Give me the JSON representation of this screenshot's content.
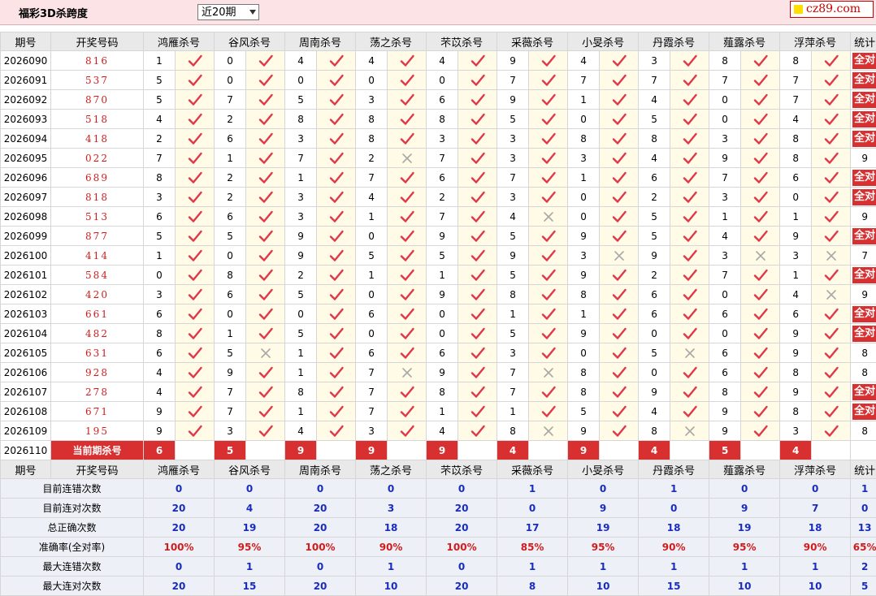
{
  "header": {
    "title": "福彩3D杀跨度",
    "select_value": "近20期",
    "logo_text": "cz89.com"
  },
  "table": {
    "col_period": "期号",
    "col_draw": "开奖号码",
    "experts": [
      "鸿雁杀号",
      "谷风杀号",
      "周南杀号",
      "荡之杀号",
      "芣苡杀号",
      "采薇杀号",
      "小旻杀号",
      "丹霞杀号",
      "薤露杀号",
      "浮萍杀号"
    ],
    "col_stat": "统计",
    "rows": [
      {
        "period": "2026090",
        "draw": "816",
        "kills": [
          1,
          0,
          4,
          4,
          4,
          9,
          4,
          3,
          8,
          8
        ],
        "marks": [
          1,
          1,
          1,
          1,
          1,
          1,
          1,
          1,
          1,
          1
        ],
        "stat": "全对"
      },
      {
        "period": "2026091",
        "draw": "537",
        "kills": [
          5,
          0,
          0,
          0,
          0,
          7,
          7,
          7,
          7,
          7
        ],
        "marks": [
          1,
          1,
          1,
          1,
          1,
          1,
          1,
          1,
          1,
          1
        ],
        "stat": "全对"
      },
      {
        "period": "2026092",
        "draw": "870",
        "kills": [
          5,
          7,
          5,
          3,
          6,
          9,
          1,
          4,
          0,
          7
        ],
        "marks": [
          1,
          1,
          1,
          1,
          1,
          1,
          1,
          1,
          1,
          1
        ],
        "stat": "全对"
      },
      {
        "period": "2026093",
        "draw": "518",
        "kills": [
          4,
          2,
          8,
          8,
          8,
          5,
          0,
          5,
          0,
          4
        ],
        "marks": [
          1,
          1,
          1,
          1,
          1,
          1,
          1,
          1,
          1,
          1
        ],
        "stat": "全对"
      },
      {
        "period": "2026094",
        "draw": "418",
        "kills": [
          2,
          6,
          3,
          8,
          3,
          3,
          8,
          8,
          3,
          8
        ],
        "marks": [
          1,
          1,
          1,
          1,
          1,
          1,
          1,
          1,
          1,
          1
        ],
        "stat": "全对"
      },
      {
        "period": "2026095",
        "draw": "022",
        "kills": [
          7,
          1,
          7,
          2,
          7,
          3,
          3,
          4,
          9,
          8
        ],
        "marks": [
          1,
          1,
          1,
          0,
          1,
          1,
          1,
          1,
          1,
          1
        ],
        "stat": "9"
      },
      {
        "period": "2026096",
        "draw": "689",
        "kills": [
          8,
          2,
          1,
          7,
          6,
          7,
          1,
          6,
          7,
          6
        ],
        "marks": [
          1,
          1,
          1,
          1,
          1,
          1,
          1,
          1,
          1,
          1
        ],
        "stat": "全对"
      },
      {
        "period": "2026097",
        "draw": "818",
        "kills": [
          3,
          2,
          3,
          4,
          2,
          3,
          0,
          2,
          3,
          0
        ],
        "marks": [
          1,
          1,
          1,
          1,
          1,
          1,
          1,
          1,
          1,
          1
        ],
        "stat": "全对"
      },
      {
        "period": "2026098",
        "draw": "513",
        "kills": [
          6,
          6,
          3,
          1,
          7,
          4,
          0,
          5,
          1,
          1
        ],
        "marks": [
          1,
          1,
          1,
          1,
          1,
          0,
          1,
          1,
          1,
          1
        ],
        "stat": "9"
      },
      {
        "period": "2026099",
        "draw": "877",
        "kills": [
          5,
          5,
          9,
          0,
          9,
          5,
          9,
          5,
          4,
          9
        ],
        "marks": [
          1,
          1,
          1,
          1,
          1,
          1,
          1,
          1,
          1,
          1
        ],
        "stat": "全对"
      },
      {
        "period": "2026100",
        "draw": "414",
        "kills": [
          1,
          0,
          9,
          5,
          5,
          9,
          3,
          9,
          3,
          3
        ],
        "marks": [
          1,
          1,
          1,
          1,
          1,
          1,
          0,
          1,
          0,
          0
        ],
        "stat": "7"
      },
      {
        "period": "2026101",
        "draw": "584",
        "kills": [
          0,
          8,
          2,
          1,
          1,
          5,
          9,
          2,
          7,
          1
        ],
        "marks": [
          1,
          1,
          1,
          1,
          1,
          1,
          1,
          1,
          1,
          1
        ],
        "stat": "全对"
      },
      {
        "period": "2026102",
        "draw": "420",
        "kills": [
          3,
          6,
          5,
          0,
          9,
          8,
          8,
          6,
          0,
          4
        ],
        "marks": [
          1,
          1,
          1,
          1,
          1,
          1,
          1,
          1,
          1,
          0
        ],
        "stat": "9"
      },
      {
        "period": "2026103",
        "draw": "661",
        "kills": [
          6,
          0,
          0,
          6,
          0,
          1,
          1,
          6,
          6,
          6
        ],
        "marks": [
          1,
          1,
          1,
          1,
          1,
          1,
          1,
          1,
          1,
          1
        ],
        "stat": "全对"
      },
      {
        "period": "2026104",
        "draw": "482",
        "kills": [
          8,
          1,
          5,
          0,
          0,
          5,
          9,
          0,
          0,
          9
        ],
        "marks": [
          1,
          1,
          1,
          1,
          1,
          1,
          1,
          1,
          1,
          1
        ],
        "stat": "全对"
      },
      {
        "period": "2026105",
        "draw": "631",
        "kills": [
          6,
          5,
          1,
          6,
          6,
          3,
          0,
          5,
          6,
          9
        ],
        "marks": [
          1,
          0,
          1,
          1,
          1,
          1,
          1,
          0,
          1,
          1
        ],
        "stat": "8"
      },
      {
        "period": "2026106",
        "draw": "928",
        "kills": [
          4,
          9,
          1,
          7,
          9,
          7,
          8,
          0,
          6,
          8
        ],
        "marks": [
          1,
          1,
          1,
          0,
          1,
          0,
          1,
          1,
          1,
          1
        ],
        "stat": "8"
      },
      {
        "period": "2026107",
        "draw": "278",
        "kills": [
          4,
          7,
          8,
          7,
          8,
          7,
          8,
          9,
          8,
          9
        ],
        "marks": [
          1,
          1,
          1,
          1,
          1,
          1,
          1,
          1,
          1,
          1
        ],
        "stat": "全对"
      },
      {
        "period": "2026108",
        "draw": "671",
        "kills": [
          9,
          7,
          1,
          7,
          1,
          1,
          5,
          4,
          9,
          8
        ],
        "marks": [
          1,
          1,
          1,
          1,
          1,
          1,
          1,
          1,
          1,
          1
        ],
        "stat": "全对"
      },
      {
        "period": "2026109",
        "draw": "195",
        "kills": [
          9,
          3,
          4,
          3,
          4,
          8,
          9,
          8,
          9,
          3
        ],
        "marks": [
          1,
          1,
          1,
          1,
          1,
          0,
          1,
          0,
          1,
          1
        ],
        "stat": "8"
      }
    ],
    "current": {
      "period": "2026110",
      "label": "当前期杀号",
      "kills": [
        "6",
        "5",
        "9",
        "9",
        "9",
        "4",
        "9",
        "4",
        "5",
        "4"
      ]
    }
  },
  "summary": {
    "col_period": "期号",
    "col_draw": "开奖号码",
    "rows": [
      {
        "label": "目前连错次数",
        "values": [
          "0",
          "0",
          "0",
          "0",
          "0",
          "1",
          "0",
          "1",
          "0",
          "0"
        ],
        "stat": "1",
        "red": false
      },
      {
        "label": "目前连对次数",
        "values": [
          "20",
          "4",
          "20",
          "3",
          "20",
          "0",
          "9",
          "0",
          "9",
          "7"
        ],
        "stat": "0",
        "red": false
      },
      {
        "label": "总正确次数",
        "values": [
          "20",
          "19",
          "20",
          "18",
          "20",
          "17",
          "19",
          "18",
          "19",
          "18"
        ],
        "stat": "13",
        "red": false
      },
      {
        "label": "准确率(全对率)",
        "values": [
          "100%",
          "95%",
          "100%",
          "90%",
          "100%",
          "85%",
          "95%",
          "90%",
          "95%",
          "90%"
        ],
        "stat": "65%",
        "red": true
      },
      {
        "label": "最大连错次数",
        "values": [
          "0",
          "1",
          "0",
          "1",
          "0",
          "1",
          "1",
          "1",
          "1",
          "1"
        ],
        "stat": "2",
        "red": false
      },
      {
        "label": "最大连对次数",
        "values": [
          "20",
          "15",
          "20",
          "10",
          "20",
          "8",
          "10",
          "15",
          "10",
          "10"
        ],
        "stat": "5",
        "red": false
      }
    ]
  },
  "colors": {
    "accent_red": "#d83030",
    "number_blue": "#1a2bbf",
    "header_pink": "#fbe3e6"
  }
}
